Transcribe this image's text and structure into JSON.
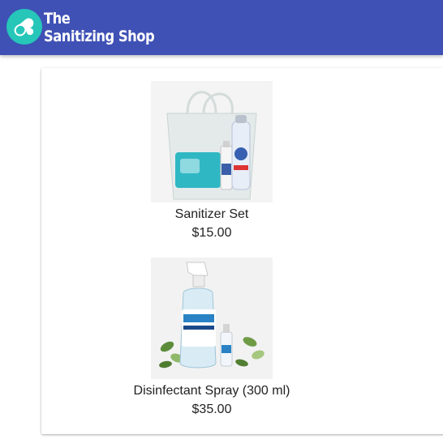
{
  "header": {
    "brand_line1": "The",
    "brand_line2": "Sanitizing Shop",
    "bg_color": "#3f51b5",
    "logo_color": "#26c6b9",
    "logo_icon": "pill-icon"
  },
  "products": [
    {
      "name": "Sanitizer Set",
      "price": "$15.00",
      "image_alt": "Sanitizer Set"
    },
    {
      "name": "Disinfectant Spray (300 ml)",
      "price": "$35.00",
      "image_alt": "Disinfectant Spray (300 ml)"
    }
  ]
}
